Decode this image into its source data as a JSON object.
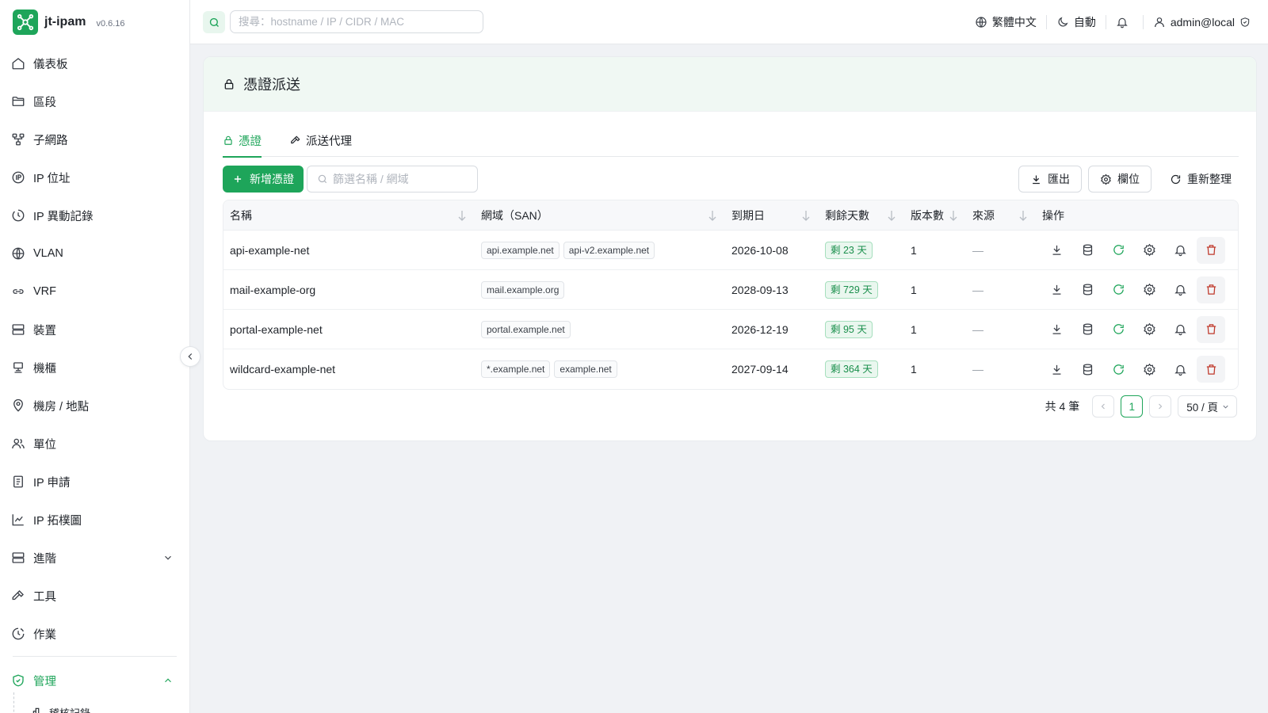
{
  "app": {
    "name": "jt-ipam",
    "version": "v0.6.16"
  },
  "sidebar": {
    "items": [
      {
        "label": "儀表板",
        "icon": "home-icon"
      },
      {
        "label": "區段",
        "icon": "folder-icon"
      },
      {
        "label": "子網路",
        "icon": "network-icon"
      },
      {
        "label": "IP 位址",
        "icon": "ip-icon"
      },
      {
        "label": "IP 異動記錄",
        "icon": "history-icon"
      },
      {
        "label": "VLAN",
        "icon": "globe-icon"
      },
      {
        "label": "VRF",
        "icon": "link-icon"
      },
      {
        "label": "裝置",
        "icon": "server-icon"
      },
      {
        "label": "機櫃",
        "icon": "rack-icon"
      },
      {
        "label": "機房 / 地點",
        "icon": "location-icon"
      },
      {
        "label": "單位",
        "icon": "users-icon"
      },
      {
        "label": "IP 申請",
        "icon": "request-icon"
      },
      {
        "label": "IP 拓樸圖",
        "icon": "chart-icon"
      },
      {
        "label": "進階",
        "icon": "layers-icon",
        "expandable": true
      },
      {
        "label": "工具",
        "icon": "hammer-icon"
      },
      {
        "label": "作業",
        "icon": "jobs-icon"
      }
    ],
    "admin": {
      "label": "管理",
      "icon": "shield-icon",
      "expanded": true
    },
    "admin_sub": {
      "label": "稽核記錄"
    }
  },
  "topbar": {
    "search_placeholder": "搜尋：hostname / IP / CIDR / MAC",
    "language": "繁體中文",
    "theme": "自動",
    "user": "admin@local"
  },
  "page": {
    "title": "憑證派送",
    "tabs": [
      {
        "label": "憑證",
        "active": true
      },
      {
        "label": "派送代理",
        "active": false
      }
    ],
    "toolbar": {
      "new_label": "新增憑證",
      "filter_placeholder": "篩選名稱 / 網域",
      "export_label": "匯出",
      "columns_label": "欄位",
      "refresh_label": "重新整理"
    },
    "table": {
      "columns": [
        "名稱",
        "網域（SAN）",
        "到期日",
        "剩餘天數",
        "版本數",
        "來源",
        "操作"
      ],
      "rows": [
        {
          "name": "api-example-net",
          "san": [
            "api.example.net",
            "api-v2.example.net"
          ],
          "expires": "2026-10-08",
          "days": "剩 23 天",
          "versions": "1",
          "source": "—"
        },
        {
          "name": "mail-example-org",
          "san": [
            "mail.example.org"
          ],
          "expires": "2028-09-13",
          "days": "剩 729 天",
          "versions": "1",
          "source": "—"
        },
        {
          "name": "portal-example-net",
          "san": [
            "portal.example.net"
          ],
          "expires": "2026-12-19",
          "days": "剩 95 天",
          "versions": "1",
          "source": "—"
        },
        {
          "name": "wildcard-example-net",
          "san": [
            "*.example.net",
            "example.net"
          ],
          "expires": "2027-09-14",
          "days": "剩 364 天",
          "versions": "1",
          "source": "—"
        }
      ]
    },
    "pagination": {
      "total": "共 4 筆",
      "current": "1",
      "page_size": "50 / 頁"
    }
  },
  "colors": {
    "accent": "#1ea55a",
    "danger": "#c0392b",
    "tag_green_bg": "#eaf7ef"
  }
}
